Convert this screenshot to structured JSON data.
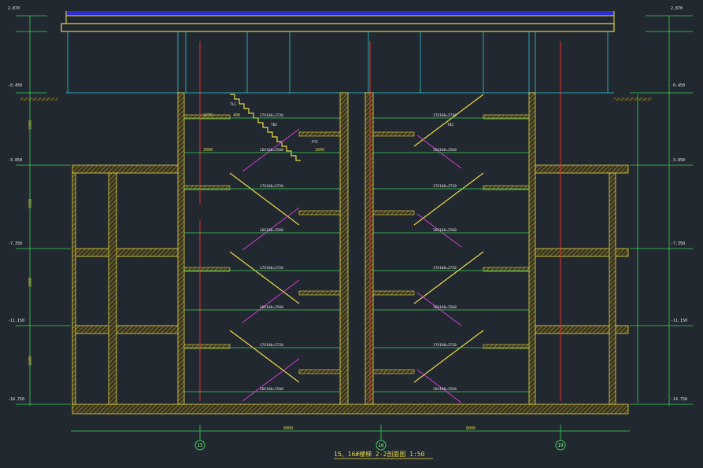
{
  "drawing": {
    "title": "15、16#楼梯 2-2剖面图  1:50",
    "axes": [
      {
        "label": "15"
      },
      {
        "label": "16"
      },
      {
        "label": "19"
      }
    ],
    "overall_dims": [
      "8000",
      "8000"
    ],
    "elevations_left": [
      "2.870",
      "-0.450",
      "-3.850",
      "-7.350",
      "-11.150",
      "-14.750"
    ],
    "elevations_right": [
      "2.870",
      "-0.450",
      "-3.850",
      "-7.350",
      "-11.150",
      "-14.750"
    ],
    "stair_labels": {
      "flight_a": "17X160=2720",
      "flight_b": "16X160=2560",
      "tl1": "TL1",
      "pti": "PTI",
      "tb1": "TB1",
      "tb2": "TB2",
      "floor_heights_left": [
        "3300",
        "3500",
        "3800",
        "3600"
      ],
      "span_labels": [
        "2270",
        "3080",
        "1600",
        "400"
      ]
    }
  },
  "colors": {
    "background": "#212830",
    "wall": "#e8d84a",
    "green": "#39d353",
    "cyan": "#2aa9b5",
    "magenta": "#d43fd4",
    "red": "#e53232",
    "white": "#e8e8e8",
    "blue": "#2d2dd0"
  }
}
